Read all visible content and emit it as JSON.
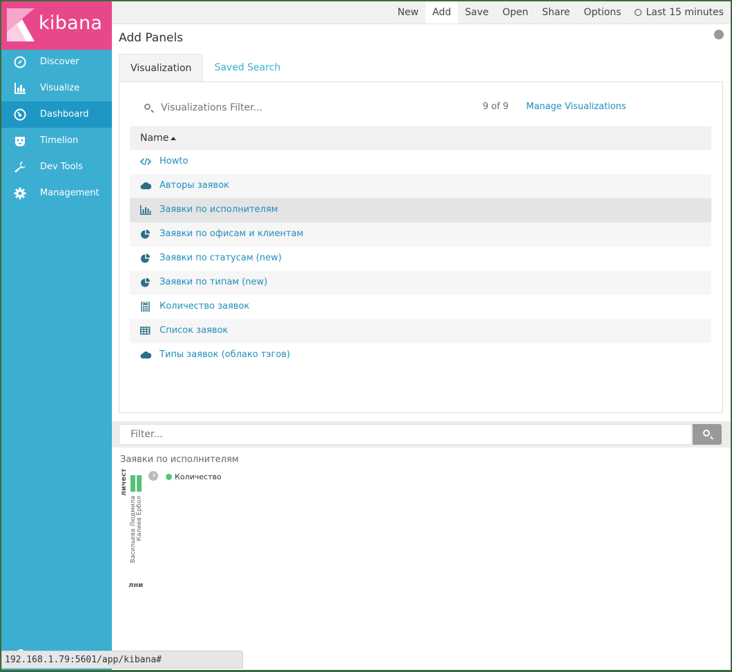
{
  "brand": {
    "name": "kibana",
    "color": "#e8488b"
  },
  "sidebar": {
    "items": [
      {
        "label": "Discover",
        "icon": "compass-icon"
      },
      {
        "label": "Visualize",
        "icon": "bar-chart-icon"
      },
      {
        "label": "Dashboard",
        "icon": "dashboard-gauge-icon",
        "active": true
      },
      {
        "label": "Timelion",
        "icon": "timelion-icon"
      },
      {
        "label": "Dev Tools",
        "icon": "wrench-icon"
      },
      {
        "label": "Management",
        "icon": "gear-icon"
      }
    ]
  },
  "topnav": {
    "new": "New",
    "add": "Add",
    "save": "Save",
    "open": "Open",
    "share": "Share",
    "options": "Options",
    "time": "Last 15 minutes"
  },
  "panel": {
    "title": "Add Panels",
    "tabs": [
      "Visualization",
      "Saved Search"
    ],
    "filter_placeholder": "Visualizations Filter...",
    "count": "9 of 9",
    "manage": "Manage Visualizations",
    "column": "Name",
    "items": [
      {
        "label": "Howto",
        "icon": "code-icon"
      },
      {
        "label": "Авторы заявок",
        "icon": "cloud-icon"
      },
      {
        "label": "Заявки по исполнителям",
        "icon": "bar-chart-icon"
      },
      {
        "label": "Заявки по офисам и клиентам",
        "icon": "pie-chart-icon"
      },
      {
        "label": "Заявки по статусам (new)",
        "icon": "pie-chart-icon"
      },
      {
        "label": "Заявки по типам (new)",
        "icon": "pie-chart-icon"
      },
      {
        "label": "Количество заявок",
        "icon": "calculator-icon"
      },
      {
        "label": "Список заявок",
        "icon": "table-icon"
      },
      {
        "label": "Типы заявок (облако тэгов)",
        "icon": "cloud-icon"
      }
    ]
  },
  "querybar": {
    "placeholder": "Filter..."
  },
  "viz": {
    "title": "Заявки по исполнителям",
    "legend": "Количество"
  },
  "chart_data": {
    "type": "bar",
    "categories": [
      "Васильева Людмила",
      "Калиев Ербол"
    ],
    "series": [
      {
        "name": "Количество",
        "values": [
          1,
          1
        ]
      }
    ],
    "ylabel": "личест",
    "xlabel": "лни",
    "color": "#57c17b"
  },
  "statusbar": {
    "url": "192.168.1.79:5601/app/kibana#"
  }
}
